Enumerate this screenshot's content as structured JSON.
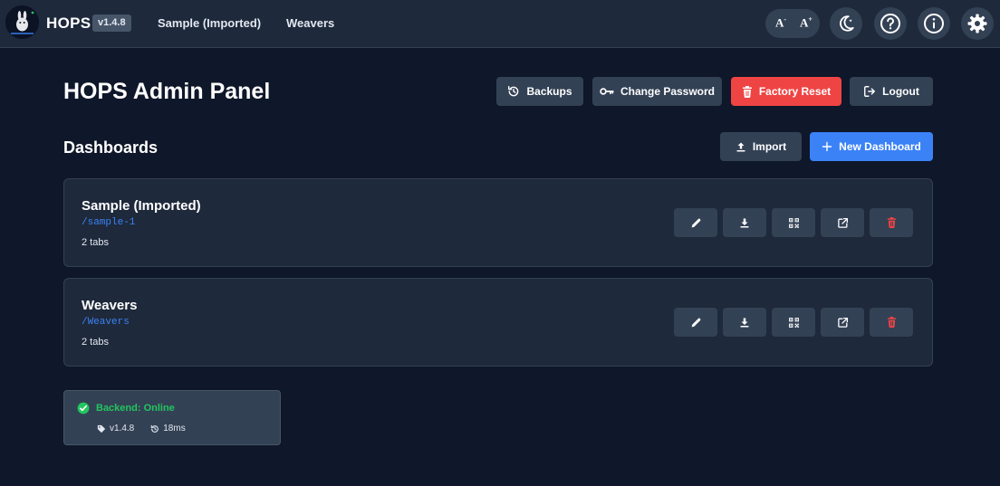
{
  "app": {
    "name": "HOPS",
    "version": "v1.4.8"
  },
  "nav": {
    "links": [
      "Sample (Imported)",
      "Weavers"
    ]
  },
  "toolbar": {
    "font_decrease_label": "A",
    "font_decrease_sup": "-",
    "font_increase_label": "A",
    "font_increase_sup": "+",
    "icons": [
      "theme-moon-icon",
      "help-icon",
      "info-icon",
      "settings-gear-icon"
    ]
  },
  "admin": {
    "title": "HOPS Admin Panel",
    "backups_label": "Backups",
    "change_password_label": "Change Password",
    "factory_reset_label": "Factory Reset",
    "logout_label": "Logout"
  },
  "dashboards": {
    "title": "Dashboards",
    "import_label": "Import",
    "new_label": "New Dashboard",
    "items": [
      {
        "name": "Sample (Imported)",
        "path": "/sample-1",
        "tabs": "2 tabs"
      },
      {
        "name": "Weavers",
        "path": "/Weavers",
        "tabs": "2 tabs"
      }
    ],
    "action_icons": [
      "edit-pencil-icon",
      "download-icon",
      "qr-code-icon",
      "open-external-icon",
      "delete-trash-icon"
    ]
  },
  "status": {
    "backend": "Backend: Online",
    "version": "v1.4.8",
    "latency": "18ms"
  },
  "colors": {
    "background": "#0f172a",
    "surface": "#1e293b",
    "button": "#334155",
    "danger": "#ef4444",
    "primary": "#3b82f6",
    "success": "#22c55e"
  }
}
